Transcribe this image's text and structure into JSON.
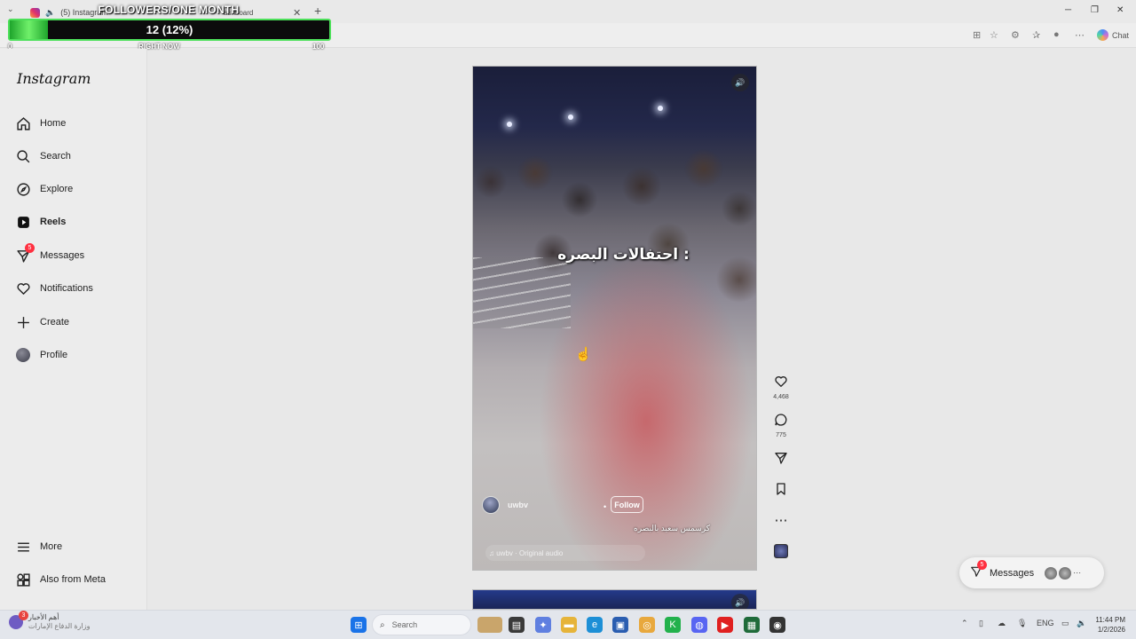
{
  "browser": {
    "tab_title": "(5) Instagram",
    "tab2_fragment": "ashboard",
    "chat_label": "Chat"
  },
  "overlay": {
    "title": "FOLLOWERS/ONE MONTH",
    "value_text": "12 (12%)",
    "progress_fraction": 0.12,
    "min_label": "0",
    "mid_label": "RIGHT NOW",
    "max_label": "100"
  },
  "instagram": {
    "logo": "Instagram",
    "nav": {
      "home": "Home",
      "search": "Search",
      "explore": "Explore",
      "reels": "Reels",
      "messages": "Messages",
      "messages_badge": "5",
      "notifications": "Notifications",
      "create": "Create",
      "profile": "Profile",
      "more": "More",
      "also_from_meta": "Also from Meta"
    },
    "reel": {
      "caption_overlay": "احتفالات البصره :",
      "username": "uwbv",
      "follow_label": "Follow",
      "description": "كرسمس سعيد بالبصره",
      "audio": "♫ uwbv · Original audio",
      "likes": "4,468",
      "comments": "775"
    },
    "messages_pill": {
      "label": "Messages",
      "badge": "5"
    }
  },
  "taskbar": {
    "news_badge": "3",
    "news_line1": "أهم الأخبار",
    "news_line2": "وزارة الدفاع الإمارات",
    "search_placeholder": "Search",
    "language": "ENG",
    "time": "11:44 PM",
    "date": "1/2/2026"
  }
}
